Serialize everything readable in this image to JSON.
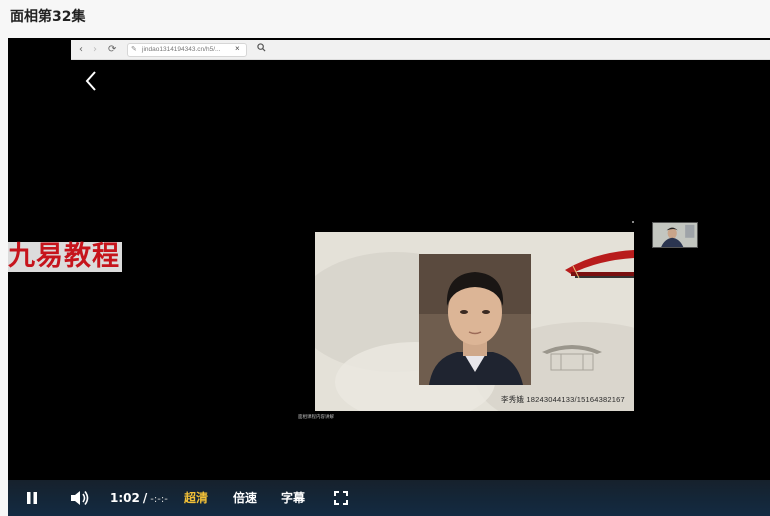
{
  "page": {
    "title": "面相第32集"
  },
  "browser": {
    "url": "jindao1314194343.cn/h5/...",
    "back_glyph": "‹",
    "forward_glyph": "›",
    "reload_glyph": "⟳",
    "close_glyph": "×",
    "search_icon": "search-icon"
  },
  "video": {
    "watermark": "九易教程",
    "slide": {
      "contact": "李秀娥  18243044133/15164382167",
      "caption": "面相课程内容讲解"
    }
  },
  "controls": {
    "current_time": "1:02",
    "separator": "/",
    "total_time": "-:-:-",
    "quality_label": "超清",
    "speed_label": "倍速",
    "subtitle_label": "字幕",
    "quality_color": "#f2c037"
  }
}
